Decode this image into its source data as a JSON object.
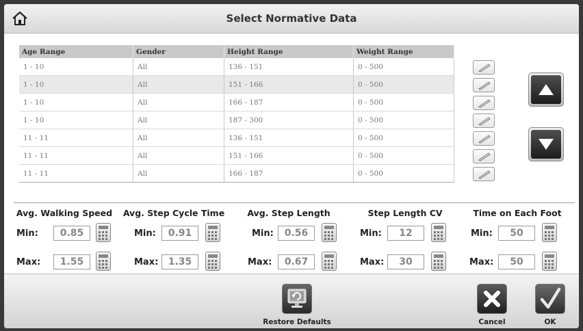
{
  "header": {
    "title": "Select Normative Data",
    "home_icon": "home-icon"
  },
  "table": {
    "columns": [
      "Age Range",
      "Gender",
      "Height Range",
      "Weight Range"
    ],
    "rows": [
      [
        "1 - 10",
        "All",
        "136 - 151",
        "0 - 500"
      ],
      [
        "1 - 10",
        "All",
        "151 - 166",
        "0 - 500"
      ],
      [
        "1 - 10",
        "All",
        "166 - 187",
        "0 - 500"
      ],
      [
        "1 - 10",
        "All",
        "187 - 300",
        "0 - 500"
      ],
      [
        "11 - 11",
        "All",
        "136 - 151",
        "0 - 500"
      ],
      [
        "11 - 11",
        "All",
        "151 - 166",
        "0 - 500"
      ],
      [
        "11 - 11",
        "All",
        "166 - 187",
        "0 - 500"
      ]
    ],
    "selected_row": 1,
    "edit_icon": "pencil-icon"
  },
  "scroll": {
    "up_icon": "triangle-up-icon",
    "down_icon": "triangle-down-icon"
  },
  "metrics": {
    "min_label": "Min:",
    "max_label": "Max:",
    "items": [
      {
        "label": "Avg. Walking Speed",
        "min": "0.85",
        "max": "1.55"
      },
      {
        "label": "Avg. Step Cycle Time",
        "min": "0.91",
        "max": "1.35"
      },
      {
        "label": "Avg. Step Length",
        "min": "0.56",
        "max": "0.67"
      },
      {
        "label": "Step Length CV",
        "min": "12",
        "max": "30"
      },
      {
        "label": "Time on Each Foot",
        "min": "50",
        "max": "50"
      }
    ]
  },
  "footer": {
    "restore_label": "Restore Defaults",
    "cancel_label": "Cancel",
    "ok_label": "OK"
  },
  "colors": {
    "dark_button": "#2a2a2a",
    "cancel_button": "#3a3a3a",
    "ok_button": "#444444"
  }
}
